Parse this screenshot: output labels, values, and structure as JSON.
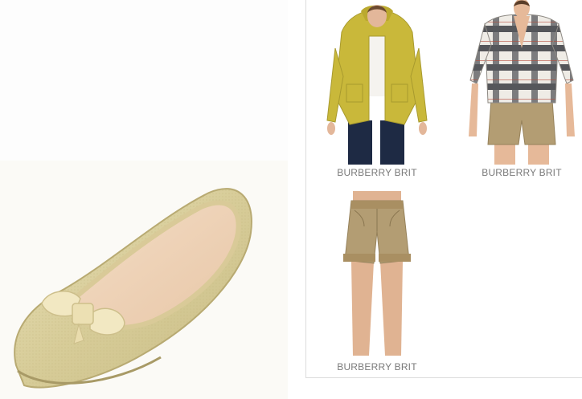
{
  "hero": {
    "image": "gold-ballet-flat-with-bow"
  },
  "products": [
    {
      "brand": "BURBERRY BRIT",
      "image": "yellow-hooded-jacket"
    },
    {
      "brand": "BURBERRY BRIT",
      "image": "check-shirt-with-khaki-shorts"
    },
    {
      "brand": "BURBERRY BRIT",
      "image": "khaki-cuffed-shorts"
    }
  ],
  "colors": {
    "jacket": "#c9b83a",
    "khaki": "#b39d73",
    "flat_gold": "#d8cfa4",
    "label_gray": "#7a7a7a",
    "divider": "#dcdcdc"
  }
}
